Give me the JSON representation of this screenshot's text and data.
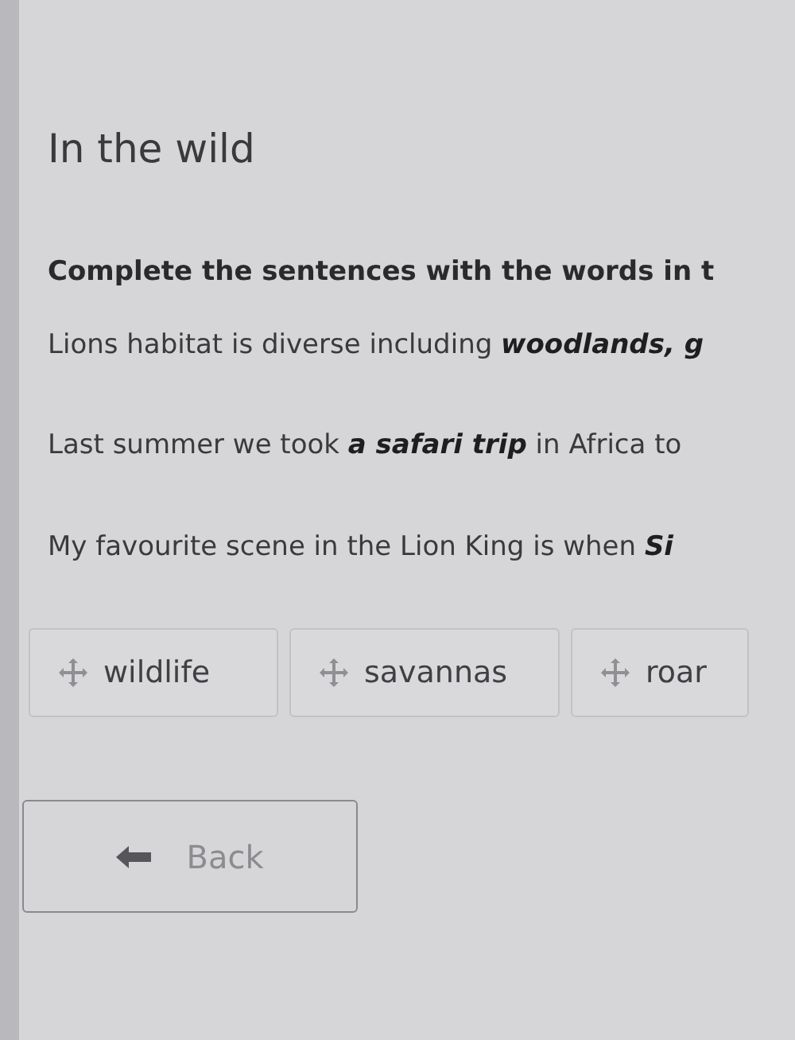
{
  "title": "In the wild",
  "instruction": "Complete the sentences with the words in t",
  "sentences": [
    "Lions habitat is diverse including **woodlands, g**",
    "Last summer we took **a safari trip** in Africa to",
    "My favourite scene in the Lion King is when **Si**"
  ],
  "words": [
    "wildlife",
    "savannas",
    "roar"
  ],
  "back_button": "Back"
}
